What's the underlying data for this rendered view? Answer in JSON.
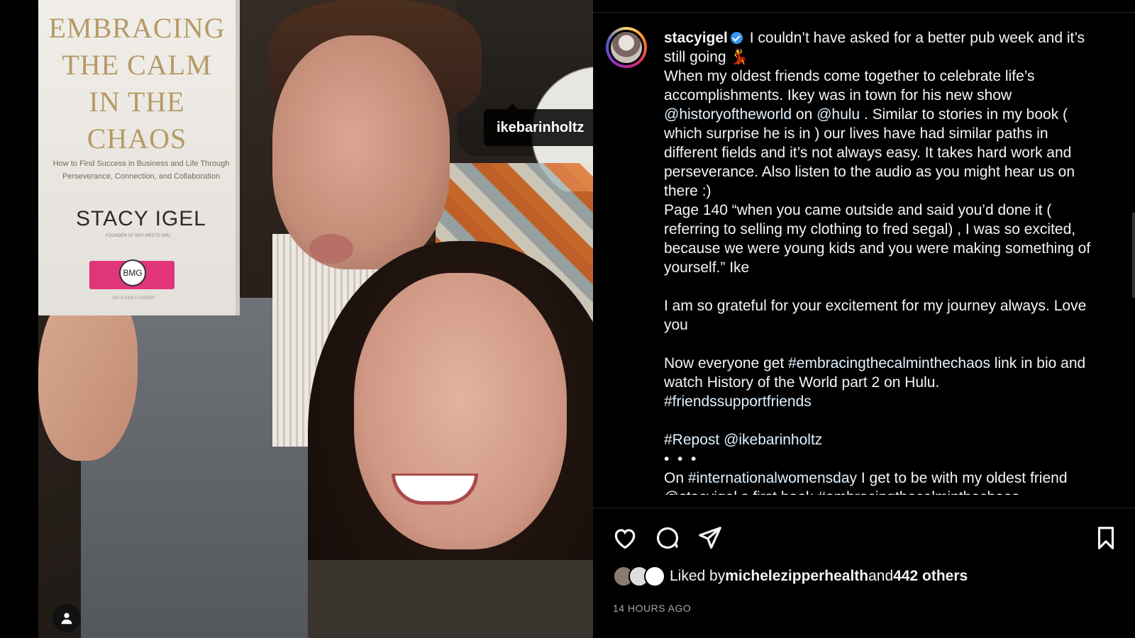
{
  "photo": {
    "book": {
      "title_lines": [
        "EMBRACING",
        "THE CALM",
        "IN THE",
        "CHAOS"
      ],
      "subtitle": "How to Find Success in Business and Life Through Perseverance, Connection, and Collaboration",
      "author": "STACY IGEL",
      "author_tag": "FOUNDER OF BOY MEETS GIRL",
      "spool_badge": "BMG",
      "footer": "WITH EMILY LIEBERT"
    },
    "tag_label": "ikebarinholtz"
  },
  "post": {
    "username": "stacyigel",
    "caption_first": " I couldn’t have asked for a better pub week and it’s still going ",
    "emoji": "💃",
    "lines": {
      "p2a": "When my oldest friends come together to celebrate life’s accomplishments. Ikey was in town for his new show ",
      "mention1": "@historyoftheworld",
      "p2b": " on ",
      "mention2": "@hulu",
      "p2c": " . Similar to stories in my book ( which surprise he is in ) our lives have had similar paths in different fields and it’s not always easy. It takes hard work and perseverance. Also listen to the audio as you might hear us on there :)",
      "p3": "Page 140 “when you came outside and said you’d done it ( referring to selling my clothing to fred segal) , I was so excited, because we were young kids and you were making something of yourself.” Ike",
      "p4": "I am so grateful for your excitement for my journey always. Love you",
      "p5a": "Now everyone get ",
      "hashtag1": "#embracingthecalminthechaos",
      "p5b": " link in bio and watch History of the World part 2 on Hulu.",
      "hashtag2": "#friendssupportfriends",
      "hashtag3": "#Repost",
      "mention3": "@ikebarinholtz",
      "dots": "•  •  •",
      "p7a": "On ",
      "hashtag4": "#internationalwomensday",
      "p7b": " I get to be with my oldest friend",
      "p8": "@stacyigel s first book #embracingthecalminthechaos"
    },
    "likes": {
      "prefix": "Liked by ",
      "user": "michelezipperhealth",
      "middle": " and ",
      "others": "442 others"
    },
    "timestamp": "14 HOURS AGO"
  },
  "icons": {
    "like": "heart-icon",
    "comment": "comment-icon",
    "share": "share-icon",
    "save": "bookmark-icon",
    "verified": "verified-badge-icon",
    "tag": "user-tag-icon"
  },
  "colors": {
    "background": "#000000",
    "text": "#f5f5f5",
    "link": "#e0f1ff",
    "verified": "#3797f0",
    "muted": "#a8a8a8"
  }
}
